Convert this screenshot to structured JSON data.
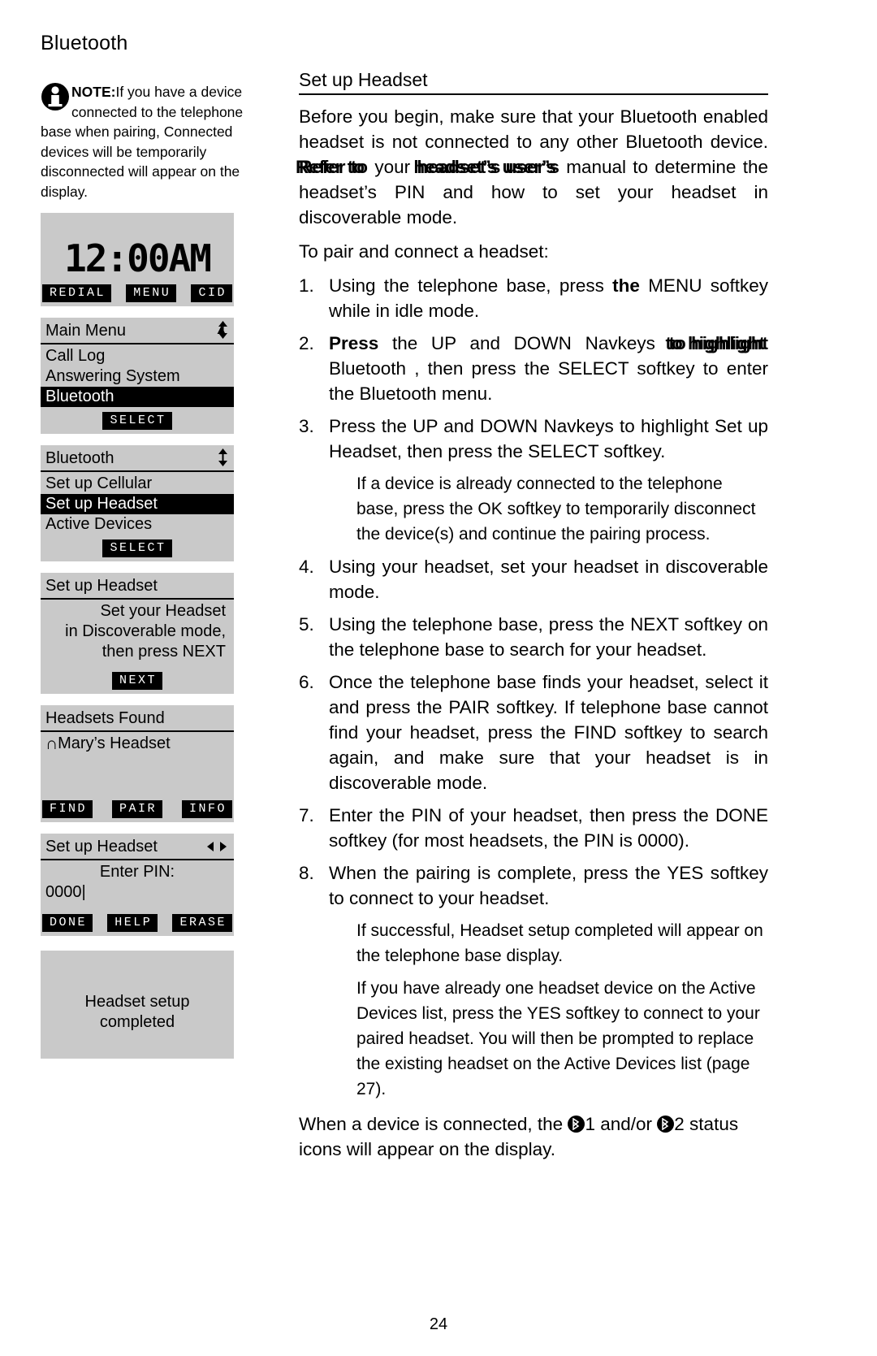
{
  "chapter": {
    "title": "Bluetooth"
  },
  "note": {
    "icon": "info-icon",
    "label": "NOTE:",
    "text": "If you have a device connected to the telephone base when pairing, Connected devices will be temporarily disconnected will appear on the display."
  },
  "screens": [
    {
      "id": "idle-clock",
      "type": "clock",
      "clock": "12:00AM",
      "softkeys": [
        "REDIAL",
        "MENU",
        "CID"
      ]
    },
    {
      "id": "main-menu",
      "type": "menu",
      "title": "Main Menu",
      "arrows": "up-down",
      "items": [
        {
          "label": "Call Log",
          "selected": false
        },
        {
          "label": "Answering System",
          "selected": false
        },
        {
          "label": "Bluetooth",
          "selected": true
        }
      ],
      "softkeys": [
        "SELECT"
      ]
    },
    {
      "id": "bluetooth-menu",
      "type": "menu",
      "title": "Bluetooth",
      "arrows": "up-down",
      "items": [
        {
          "label": "Set up Cellular",
          "selected": false
        },
        {
          "label": "Set up Headset",
          "selected": true
        },
        {
          "label": "Active Devices",
          "selected": false
        }
      ],
      "softkeys": [
        "SELECT"
      ]
    },
    {
      "id": "discoverable-prompt",
      "type": "message",
      "title": "Set up Headset",
      "lines": [
        "Set your Headset",
        "in Discoverable mode,",
        "then press NEXT"
      ],
      "softkeys": [
        "NEXT"
      ]
    },
    {
      "id": "headsets-found",
      "type": "list",
      "title": "Headsets Found",
      "items": [
        {
          "icon": "headset-icon",
          "label": "Mary’s Headset"
        }
      ],
      "softkeys": [
        "FIND",
        "PAIR",
        "INFO"
      ]
    },
    {
      "id": "enter-pin",
      "type": "input",
      "title": "Set up Headset",
      "arrows": "left-right",
      "prompt": "Enter PIN:",
      "value": "0000",
      "softkeys": [
        "DONE",
        "HELP",
        "ERASE"
      ]
    },
    {
      "id": "setup-complete",
      "type": "message-plain",
      "lines": [
        "Headset setup",
        "completed"
      ],
      "softkeys": []
    }
  ],
  "section": {
    "heading": "Set up Headset",
    "intro_1": "Before you begin, make sure that your Bluetooth enabled headset is not connected to any other Bluetooth device. ",
    "intro_bold_1": "Refer to",
    "intro_2": " your ",
    "intro_bold_2": "headset’s user’s",
    "intro_3": " manual to determine the headset’s PIN and how to set your headset in discoverable mode.",
    "lead_in": "To pair and connect a headset:",
    "steps": [
      {
        "num": "1.",
        "pre": "Using the telephone base, press ",
        "bold": "the",
        "post": " MENU softkey while in idle mode."
      },
      {
        "num": "2.",
        "bold_lead": "Press",
        "pre": " the UP and DOWN Navkeys ",
        "bold": "to highlight",
        "post": " Bluetooth , then press the SELECT softkey to enter the Bluetooth  menu."
      },
      {
        "num": "3.",
        "pre": "Press the UP and DOWN Navkeys to highlight Set up Headset, then press the SELECT softkey.",
        "sub": "If a device is already connected to the telephone base, press the OK softkey to temporarily disconnect the device(s) and continue the pairing process."
      },
      {
        "num": "4.",
        "pre": "Using your headset, set your headset in discoverable mode."
      },
      {
        "num": "5.",
        "pre": "Using the telephone base, press the NEXT softkey on the telephone base to search for your headset."
      },
      {
        "num": "6.",
        "pre": "Once the telephone base finds your headset, select it and press the  PAIR softkey. If telephone base cannot find your headset, press the  FIND softkey to search again, and make sure that your headset is in discoverable mode."
      },
      {
        "num": "7.",
        "pre": "Enter the PIN of your headset, then press the  DONE softkey (for most headsets, the PIN is 0000)."
      },
      {
        "num": "8.",
        "pre": "When the pairing is complete, press the  YES softkey to connect to your headset.",
        "sub": "If successful, Headset setup completed   will appear on the telephone base display.",
        "sub2": "If you have already one headset device on the Active Devices  list, press the  YES softkey to connect to your paired headset. You will then be prompted to replace the existing headset on the Active Devices  list (page 27)."
      }
    ],
    "closing_1": "When a device is connected, the ",
    "closing_n1": "1",
    "closing_2": " and/or ",
    "closing_n2": "2",
    "closing_3": " status icons will appear on the display."
  },
  "footer": {
    "page_number": "24"
  }
}
